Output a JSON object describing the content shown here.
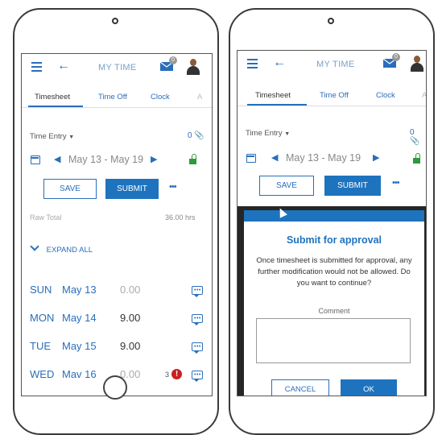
{
  "left": {
    "header": {
      "title": "MY TIME",
      "mail_badge": "0"
    },
    "tabs": [
      "Timesheet",
      "Time Off",
      "Clock",
      "A"
    ],
    "time_entry": {
      "label": "Time Entry",
      "attach_count": "0"
    },
    "week": {
      "range": "May 13 - May 19"
    },
    "actions": {
      "save": "SAVE",
      "submit": "SUBMIT",
      "more": "•••"
    },
    "raw_total": {
      "label": "Raw Total",
      "value": "36.00 hrs"
    },
    "expand_all": "EXPAND ALL",
    "days": [
      {
        "day": "SUN",
        "date": "May 13",
        "hours": "0.00",
        "muted": true,
        "warn": ""
      },
      {
        "day": "MON",
        "date": "May 14",
        "hours": "9.00",
        "muted": false,
        "warn": ""
      },
      {
        "day": "TUE",
        "date": "May 15",
        "hours": "9.00",
        "muted": false,
        "warn": ""
      },
      {
        "day": "WED",
        "date": "Mav 16",
        "hours": "0.00",
        "muted": true,
        "warn": "3"
      }
    ]
  },
  "right": {
    "header": {
      "title": "MY TIME",
      "mail_badge": "0"
    },
    "tabs": [
      "Timesheet",
      "Time Off",
      "Clock",
      "A"
    ],
    "time_entry": {
      "label": "Time Entry",
      "attach_count": "0"
    },
    "week": {
      "range": "May 13 - May 19"
    },
    "actions": {
      "save": "SAVE",
      "submit": "SUBMIT",
      "more": "•••"
    },
    "dialog": {
      "title": "Submit for approval",
      "message": "Once timesheet is submitted for approval, any further modification would not be allowed. Do you want to continue?",
      "comment_label": "Comment",
      "comment_value": "",
      "cancel": "CANCEL",
      "ok": "OK"
    }
  },
  "colors": {
    "accent": "#1e73be",
    "link": "#2a6ebb",
    "green": "#2e9a3e",
    "warn": "#cc1f1f"
  }
}
